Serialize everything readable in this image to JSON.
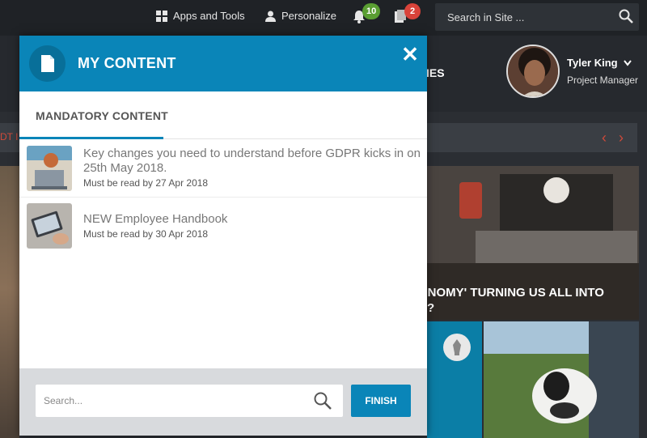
{
  "topbar": {
    "apps_label": "Apps and Tools",
    "personalize_label": "Personalize",
    "notifications_count": "10",
    "documents_count": "2",
    "search_placeholder": "Search in Site ..."
  },
  "header": {
    "nav_partial": "IES",
    "user_name": "Tyler King",
    "user_role": "Project Manager"
  },
  "ticker": {
    "partial_text": "DT I",
    "prev_arrow": "‹",
    "next_arrow": "›"
  },
  "background": {
    "headline_line1": "ONOMY' TURNING US ALL INTO",
    "headline_line2": "?"
  },
  "modal": {
    "title": "MY CONTENT",
    "close_glyph": "✕",
    "tab_label": "MANDATORY CONTENT",
    "items": [
      {
        "title": "Key changes you need to understand before GDPR kicks in on 25th May 2018.",
        "due": "Must be read by 27 Apr 2018"
      },
      {
        "title": "NEW Employee Handbook",
        "due": "Must be read by 30 Apr 2018"
      }
    ],
    "search_placeholder": "Search...",
    "finish_label": "FINISH"
  },
  "colors": {
    "accent": "#0a85b8",
    "badge_green": "#5a9e32",
    "badge_red": "#d9433a",
    "topbar_bg": "#1f2226"
  },
  "icons": [
    "windows-icon",
    "user-icon",
    "bell-icon",
    "document-icon",
    "search-icon",
    "close-icon",
    "chevron-down-icon",
    "pen-icon"
  ]
}
